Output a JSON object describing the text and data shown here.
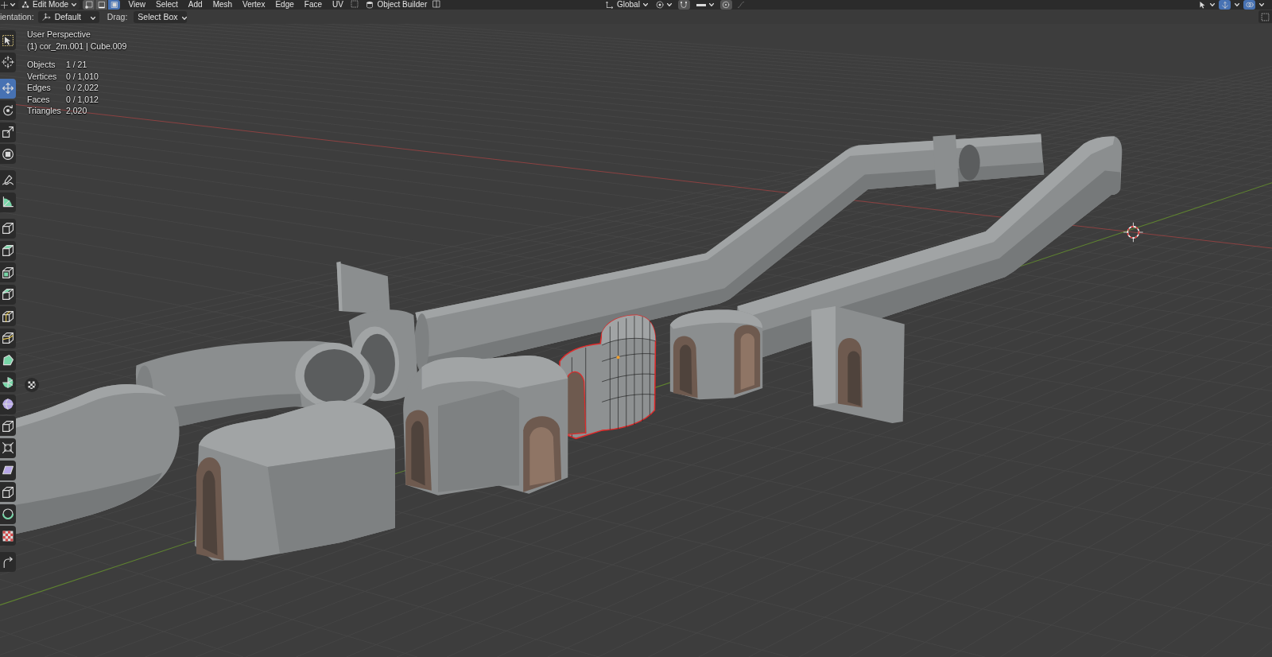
{
  "header": {
    "mode": "Edit Mode",
    "select_modes": [
      {
        "selected": false
      },
      {
        "selected": false
      },
      {
        "selected": true
      }
    ],
    "menus": [
      "View",
      "Select",
      "Add",
      "Mesh",
      "Vertex",
      "Edge",
      "Face",
      "UV"
    ],
    "addon_menu": "Object Builder",
    "orientation": "Global",
    "snap": {
      "on": false
    },
    "proportional_editing": {
      "on": false
    },
    "gizmos": {
      "on": true
    },
    "overlays": {
      "on": true
    }
  },
  "tool_settings": {
    "orientation_label": "ientation:",
    "orientation": "Default",
    "drag_label": "Drag:",
    "drag": "Select Box"
  },
  "toolbar": {
    "groups": [
      {
        "tools": [
          {
            "selected": false
          },
          {
            "selected": false
          }
        ]
      },
      {
        "tools": [
          {
            "selected": true
          },
          {
            "selected": false
          },
          {
            "selected": false
          },
          {
            "selected": false
          }
        ]
      },
      {
        "tools": [
          {
            "selected": false
          },
          {
            "selected": false
          }
        ]
      },
      {
        "tools": [
          {
            "selected": false
          },
          {
            "selected": false
          },
          {
            "selected": false
          },
          {
            "selected": false
          },
          {
            "selected": false
          },
          {
            "selected": false
          },
          {
            "selected": false
          },
          {
            "selected": false
          },
          {
            "selected": false
          },
          {
            "selected": false
          },
          {
            "selected": false
          },
          {
            "selected": false
          },
          {
            "selected": false
          },
          {
            "selected": false
          },
          {
            "selected": false
          }
        ]
      },
      {
        "tools": [
          {
            "selected": false
          }
        ]
      }
    ]
  },
  "viewport": {
    "view_name": "User Perspective",
    "active_object": "(1) cor_2m.001 | Cube.009",
    "stats": [
      {
        "label": "Objects",
        "value": "1 / 21"
      },
      {
        "label": "Vertices",
        "value": "0 / 1,010"
      },
      {
        "label": "Edges",
        "value": "0 / 2,022"
      },
      {
        "label": "Faces",
        "value": "0 / 1,012"
      },
      {
        "label": "Triangles",
        "value": "2,020"
      }
    ]
  }
}
